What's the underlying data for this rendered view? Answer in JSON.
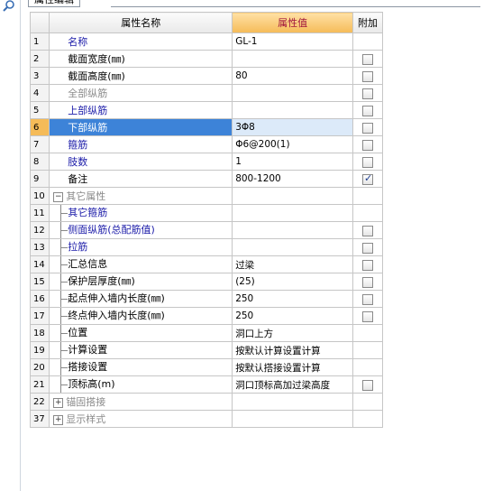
{
  "tab": {
    "label": "属性编辑"
  },
  "columns": {
    "name": "属性名称",
    "value": "属性值",
    "add": "附加"
  },
  "rows": [
    {
      "num": "1",
      "name": "名称",
      "value": "GL-1",
      "style": "blue",
      "check": "none"
    },
    {
      "num": "2",
      "name": "截面宽度(㎜)",
      "value": "",
      "style": "black",
      "check": "off"
    },
    {
      "num": "3",
      "name": "截面高度(㎜)",
      "value": "80",
      "style": "black",
      "check": "off"
    },
    {
      "num": "4",
      "name": "全部纵筋",
      "value": "",
      "style": "gray",
      "check": "off"
    },
    {
      "num": "5",
      "name": "上部纵筋",
      "value": "",
      "style": "blue",
      "check": "off"
    },
    {
      "num": "6",
      "name": "下部纵筋",
      "value": "3Φ8",
      "style": "selected",
      "check": "off"
    },
    {
      "num": "7",
      "name": "箍筋",
      "value": "Φ6@200(1)",
      "style": "blue",
      "check": "off"
    },
    {
      "num": "8",
      "name": "肢数",
      "value": "1",
      "style": "blue",
      "check": "off"
    },
    {
      "num": "9",
      "name": "备注",
      "value": "800-1200",
      "style": "black",
      "check": "on"
    },
    {
      "num": "10",
      "name": "其它属性",
      "value": "",
      "style": "gray",
      "check": "none",
      "tree": "minus"
    },
    {
      "num": "11",
      "name": "其它箍筋",
      "value": "",
      "style": "blue",
      "check": "none",
      "tree": "child"
    },
    {
      "num": "12",
      "name": "侧面纵筋(总配筋值)",
      "value": "",
      "style": "blue",
      "check": "off",
      "tree": "child"
    },
    {
      "num": "13",
      "name": "拉筋",
      "value": "",
      "style": "blue",
      "check": "off",
      "tree": "child"
    },
    {
      "num": "14",
      "name": "汇总信息",
      "value": "过梁",
      "style": "black",
      "check": "off",
      "tree": "child"
    },
    {
      "num": "15",
      "name": "保护层厚度(㎜)",
      "value": "(25)",
      "style": "black",
      "check": "off",
      "tree": "child"
    },
    {
      "num": "16",
      "name": "起点伸入墙内长度(㎜)",
      "value": "250",
      "style": "black",
      "check": "off",
      "tree": "child"
    },
    {
      "num": "17",
      "name": "终点伸入墙内长度(㎜)",
      "value": "250",
      "style": "black",
      "check": "off",
      "tree": "child"
    },
    {
      "num": "18",
      "name": "位置",
      "value": "洞口上方",
      "style": "black",
      "check": "none",
      "tree": "child"
    },
    {
      "num": "19",
      "name": "计算设置",
      "value": "按默认计算设置计算",
      "style": "black",
      "check": "none",
      "tree": "child"
    },
    {
      "num": "20",
      "name": "搭接设置",
      "value": "按默认搭接设置计算",
      "style": "black",
      "check": "none",
      "tree": "child"
    },
    {
      "num": "21",
      "name": "顶标高(m)",
      "value": "洞口顶标高加过梁高度",
      "style": "black",
      "check": "off",
      "tree": "child"
    },
    {
      "num": "22",
      "name": "锚固搭接",
      "value": "",
      "style": "gray",
      "check": "none",
      "tree": "plus"
    },
    {
      "num": "37",
      "name": "显示样式",
      "value": "",
      "style": "gray",
      "check": "none",
      "tree": "plus"
    }
  ]
}
